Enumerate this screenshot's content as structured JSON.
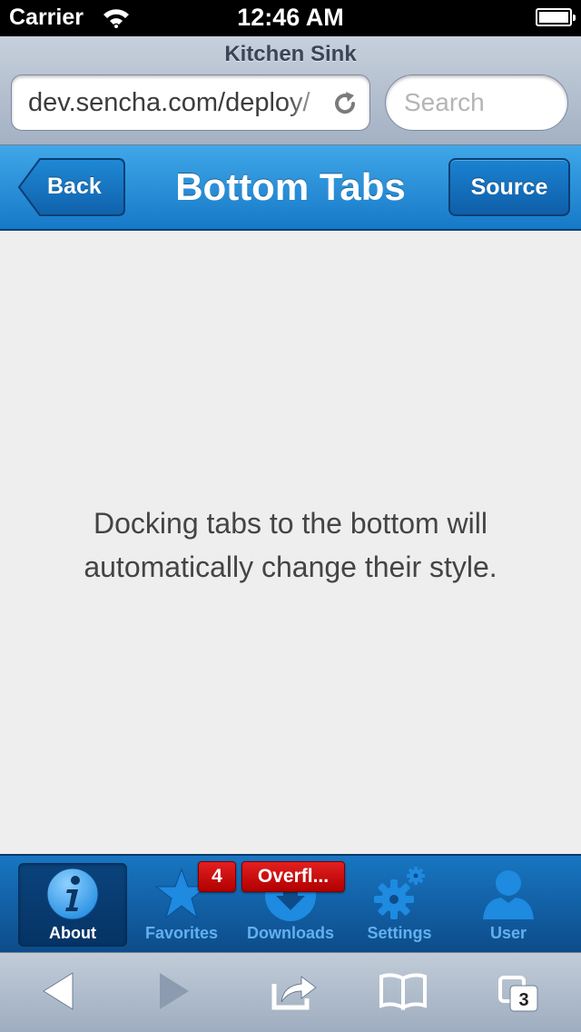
{
  "status_bar": {
    "carrier": "Carrier",
    "time": "12:46 AM"
  },
  "browser": {
    "page_title": "Kitchen Sink",
    "url": "dev.sencha.com/deploy/",
    "search_placeholder": "Search",
    "tabs_count": "3"
  },
  "toolbar": {
    "title": "Bottom Tabs",
    "back_label": "Back",
    "source_label": "Source"
  },
  "content": {
    "message": "Docking tabs to the bottom will automatically change their style."
  },
  "tab_bar": {
    "tabs": [
      {
        "label": "About",
        "icon": "info-icon",
        "active": true
      },
      {
        "label": "Favorites",
        "icon": "star-icon",
        "badge": "4"
      },
      {
        "label": "Downloads",
        "icon": "download-icon",
        "badge": "Overfl..."
      },
      {
        "label": "Settings",
        "icon": "gear-icon"
      },
      {
        "label": "User",
        "icon": "user-icon"
      }
    ]
  },
  "colors": {
    "toolbar_blue": "#1679c8",
    "tab_bar_blue": "#0d4c8a",
    "badge_red": "#d10000",
    "content_bg": "#eeeeee"
  }
}
